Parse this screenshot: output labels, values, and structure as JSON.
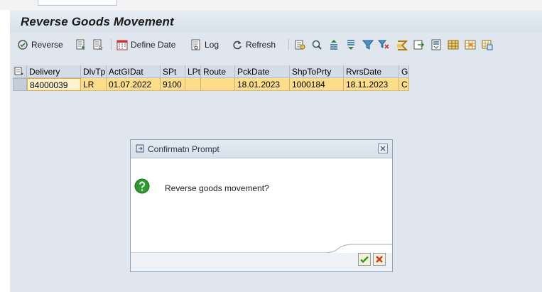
{
  "window": {
    "title": "Reverse Goods Movement"
  },
  "toolbar": {
    "reverse_label": "Reverse",
    "define_date_label": "Define Date",
    "log_label": "Log",
    "refresh_label": "Refresh"
  },
  "table": {
    "columns": [
      "Delivery",
      "DlvTp",
      "ActGIDat",
      "SPt",
      "LPt",
      "Route",
      "PckDate",
      "ShpToPrty",
      "RvrsDate",
      "G"
    ],
    "rows": [
      [
        "84000039",
        "LR",
        "01.07.2022",
        "9100",
        "",
        "",
        "18.01.2023",
        "1000184",
        "18.11.2023",
        "C"
      ]
    ]
  },
  "dialog": {
    "title": "Confirmatn Prompt",
    "message": "Reverse goods movement?"
  },
  "colors": {
    "selected_row": "#fddc8a",
    "header_bg": "#d4dde7",
    "ok_check": "#2e9a2e",
    "cancel_x": "#d23a1e"
  }
}
